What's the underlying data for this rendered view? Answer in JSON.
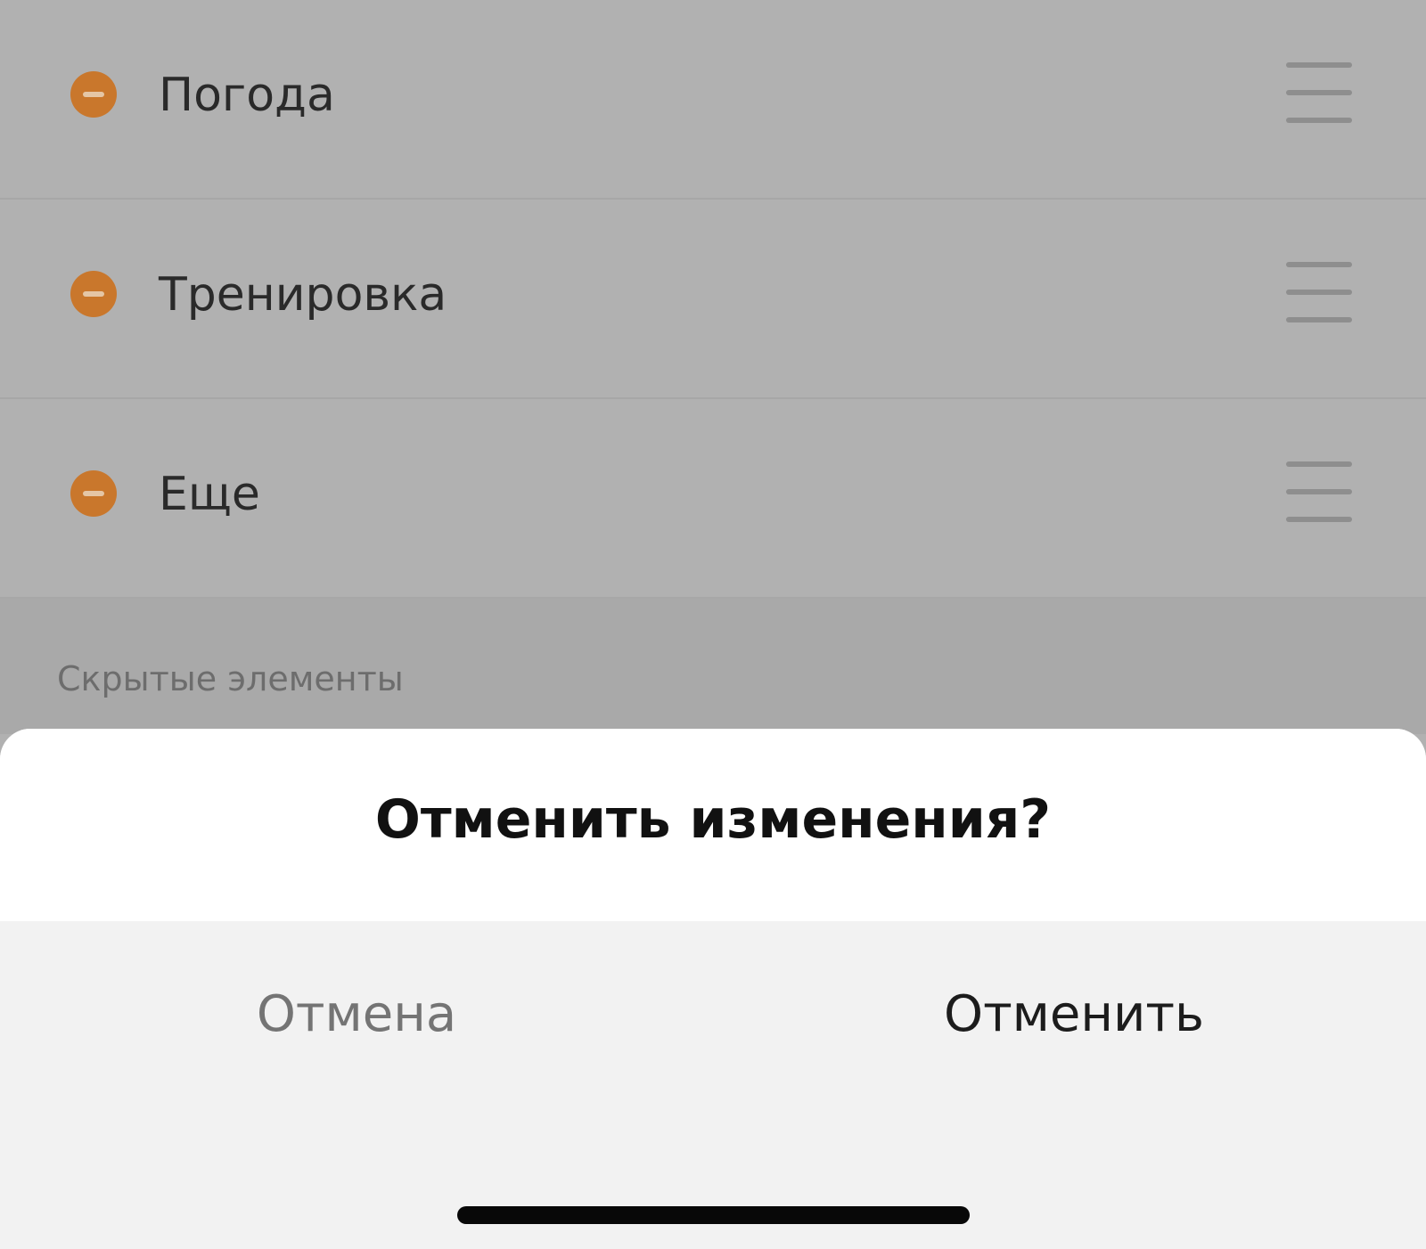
{
  "list": {
    "items": [
      {
        "label": "Погода",
        "remove_icon": "minus-circle-icon",
        "handle_icon": "drag-handle-icon"
      },
      {
        "label": "Тренировка",
        "remove_icon": "minus-circle-icon",
        "handle_icon": "drag-handle-icon"
      },
      {
        "label": "Еще",
        "remove_icon": "minus-circle-icon",
        "handle_icon": "drag-handle-icon"
      }
    ],
    "hidden_section_header": "Скрытые элементы"
  },
  "dialog": {
    "title": "Отменить изменения?",
    "cancel_label": "Отмена",
    "discard_label": "Отменить"
  },
  "colors": {
    "remove_accent": "#c9772c",
    "overlay_background": "#b1b1b1",
    "sheet_background": "#f2f2f2",
    "title_background": "#ffffff"
  }
}
